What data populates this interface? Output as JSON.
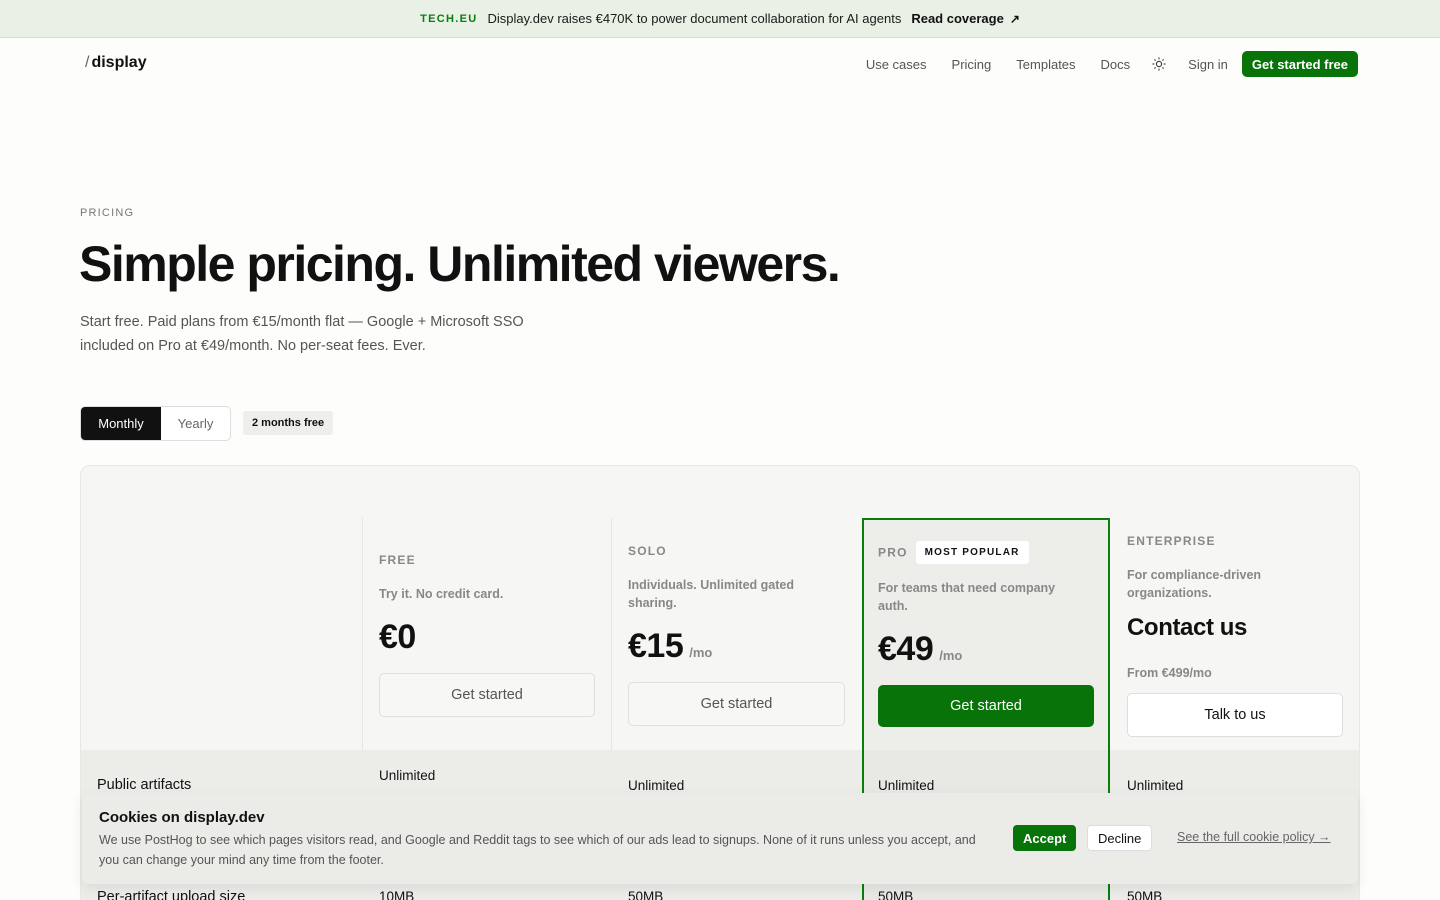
{
  "announcement": {
    "source": "TECH.EU",
    "message": "Display.dev raises €470K to power document collaboration for AI agents",
    "link": "Read coverage",
    "arrow": "↗"
  },
  "nav": {
    "logo_slash": "/",
    "logo_word": "display",
    "links": [
      "Use cases",
      "Pricing",
      "Templates",
      "Docs"
    ],
    "theme_icon": "sun-icon",
    "signin": "Sign in",
    "cta": "Get started free"
  },
  "hero": {
    "eyebrow": "PRICING",
    "title": "Simple pricing. Unlimited viewers.",
    "subtitle": "Start free. Paid plans from €15/month flat — Google + Microsoft SSO included on Pro at €49/month. No per-seat fees. Ever."
  },
  "billing": {
    "monthly": "Monthly",
    "yearly": "Yearly",
    "selected": "Monthly",
    "badge": "2 months free"
  },
  "plans": {
    "free": {
      "tier": "FREE",
      "desc": "Try it. No credit card.",
      "price": "€0",
      "button": "Get started"
    },
    "solo": {
      "tier": "SOLO",
      "desc": "Individuals. Unlimited gated sharing.",
      "price": "€15",
      "per": "/mo",
      "button": "Get started"
    },
    "pro": {
      "tier": "PRO",
      "badge": "MOST POPULAR",
      "desc": "For teams that need company auth.",
      "price": "€49",
      "per": "/mo",
      "button": "Get started"
    },
    "enterprise": {
      "tier": "ENTERPRISE",
      "desc": "For compliance-driven organizations.",
      "price": "Contact us",
      "from": "From €499/mo",
      "button": "Talk to us"
    }
  },
  "features": {
    "public_artifacts": {
      "label": "Public artifacts",
      "free": "Unlimited",
      "solo": "Unlimited",
      "pro": "Unlimited",
      "enterprise": "Unlimited"
    },
    "upload_size": {
      "label": "Per-artifact upload size",
      "free": "10MB",
      "solo": "50MB",
      "pro": "50MB",
      "enterprise": "50MB"
    }
  },
  "cookie": {
    "title": "Cookies on display.dev",
    "text": "We use PostHog to see which pages visitors read, and Google and Reddit tags to see which of our ads lead to signups. None of it runs unless you accept, and you can change your mind any time from the footer.",
    "accept": "Accept",
    "decline": "Decline",
    "policy": "See the full cookie policy →"
  },
  "colors": {
    "accent": "#087308",
    "accent_text": "#0a7d0a",
    "background": "#fdfdfc",
    "banner": "#e9f1e6"
  }
}
